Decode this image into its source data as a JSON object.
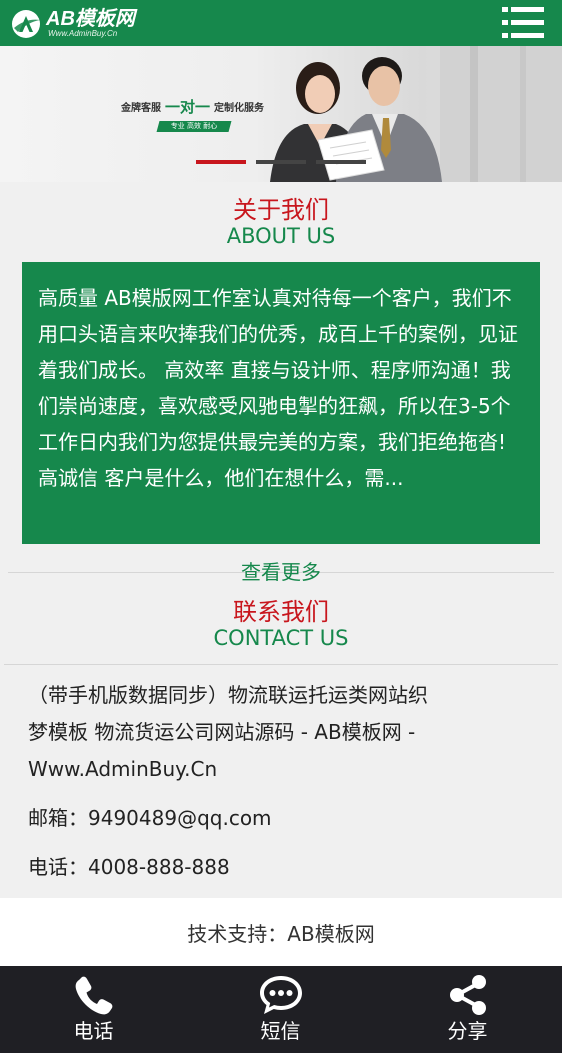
{
  "header": {
    "logo_main": "AB模板网",
    "logo_sub": "Www.AdminBuy.Cn",
    "menu_icon": "hamburger-menu-icon"
  },
  "banner": {
    "slogan_left": "金牌客服",
    "slogan_big": "一对一",
    "slogan_right": "定制化服务",
    "slogan_tag": "专业 高效 耐心",
    "slide_count": 3,
    "active_slide": 1
  },
  "about": {
    "title_cn": "关于我们",
    "title_en": "ABOUT US",
    "text": "高质量 AB模版网工作室认真对待每一个客户，我们不用口头语言来吹捧我们的优秀，成百上千的案例，见证着我们成长。 高效率 直接与设计师、程序师沟通！我们崇尚速度，喜欢感受风驰电掣的狂飙，所以在3-5个工作日内我们为您提供最完美的方案，我们拒绝拖沓! 高诚信 客户是什么，他们在想什么，需...",
    "more_link": "查看更多"
  },
  "contact": {
    "title_cn": "联系我们",
    "title_en": "CONTACT US",
    "site_name": "（带手机版数据同步）物流联运托运类网站织梦模板 物流货运公司网站源码 - AB模板网 - Www.AdminBuy.Cn",
    "email": "邮箱：9490489@qq.com",
    "phone": "电话：4008-888-888"
  },
  "footer": {
    "support": "技术支持：AB模板网"
  },
  "bottom_nav": {
    "items": [
      {
        "label": "电话",
        "icon": "phone-icon"
      },
      {
        "label": "短信",
        "icon": "chat-bubble-icon"
      },
      {
        "label": "分享",
        "icon": "share-icon"
      }
    ]
  },
  "colors": {
    "brand_green": "#16884c",
    "accent_red": "#c8161d",
    "nav_dark": "#1f1f24"
  }
}
